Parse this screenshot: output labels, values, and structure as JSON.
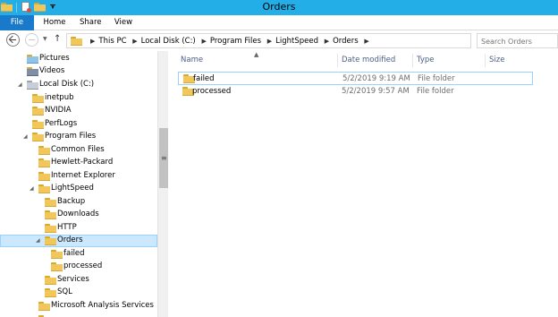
{
  "window": {
    "title": "Orders",
    "accent": "#23aee8"
  },
  "ribbon": {
    "tabs": [
      {
        "label": "File",
        "active": true
      },
      {
        "label": "Home"
      },
      {
        "label": "Share"
      },
      {
        "label": "View"
      }
    ]
  },
  "address": {
    "crumbs": [
      "This PC",
      "Local Disk (C:)",
      "Program Files",
      "LightSpeed",
      "Orders"
    ]
  },
  "search": {
    "placeholder": "Search Orders"
  },
  "nav": {
    "items": [
      {
        "label": "Pictures",
        "icon": "pictures-icon",
        "level": 1
      },
      {
        "label": "Videos",
        "icon": "videos-icon",
        "level": 1
      },
      {
        "label": "Local Disk (C:)",
        "icon": "drive-icon",
        "level": 1
      },
      {
        "label": "inetpub",
        "icon": "folder-icon",
        "level": 2
      },
      {
        "label": "NVIDIA",
        "icon": "folder-icon",
        "level": 2
      },
      {
        "label": "PerfLogs",
        "icon": "folder-icon",
        "level": 2
      },
      {
        "label": "Program Files",
        "icon": "folder-icon",
        "level": 2
      },
      {
        "label": "Common Files",
        "icon": "folder-icon",
        "level": 3
      },
      {
        "label": "Hewlett-Packard",
        "icon": "folder-icon",
        "level": 3
      },
      {
        "label": "Internet Explorer",
        "icon": "folder-icon",
        "level": 3
      },
      {
        "label": "LightSpeed",
        "icon": "folder-icon",
        "level": 3
      },
      {
        "label": "Backup",
        "icon": "folder-icon",
        "level": 4
      },
      {
        "label": "Downloads",
        "icon": "folder-icon",
        "level": 4
      },
      {
        "label": "HTTP",
        "icon": "folder-icon",
        "level": 4
      },
      {
        "label": "Orders",
        "icon": "folder-icon",
        "level": 4,
        "selected": true
      },
      {
        "label": "failed",
        "icon": "folder-icon",
        "level": 5
      },
      {
        "label": "processed",
        "icon": "folder-icon",
        "level": 5
      },
      {
        "label": "Services",
        "icon": "folder-icon",
        "level": 4
      },
      {
        "label": "SQL",
        "icon": "folder-icon",
        "level": 4
      },
      {
        "label": "Microsoft Analysis Services",
        "icon": "folder-icon",
        "level": 3
      }
    ]
  },
  "columns": {
    "name": "Name",
    "date": "Date modified",
    "type": "Type",
    "size": "Size"
  },
  "files": [
    {
      "name": "failed",
      "date": "5/2/2019 9:19 AM",
      "type": "File folder",
      "size": ""
    },
    {
      "name": "processed",
      "date": "5/2/2019 9:57 AM",
      "type": "File folder",
      "size": ""
    }
  ]
}
